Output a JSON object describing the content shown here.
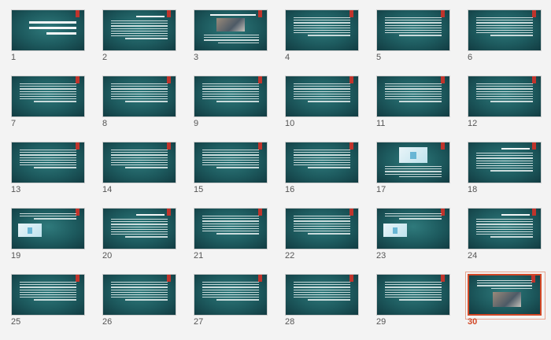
{
  "window": {
    "title": ""
  },
  "slides": [
    {
      "number": "1",
      "layout": "title",
      "title_text": "پاورپوینت مدیریت داده چه چیزی است و چه اهمیتی در کسب و کار ها دارد؟"
    },
    {
      "number": "2",
      "layout": "text-title"
    },
    {
      "number": "3",
      "layout": "photo-top"
    },
    {
      "number": "4",
      "layout": "text"
    },
    {
      "number": "5",
      "layout": "text"
    },
    {
      "number": "6",
      "layout": "text"
    },
    {
      "number": "7",
      "layout": "text"
    },
    {
      "number": "8",
      "layout": "text"
    },
    {
      "number": "9",
      "layout": "text"
    },
    {
      "number": "10",
      "layout": "text"
    },
    {
      "number": "11",
      "layout": "text"
    },
    {
      "number": "12",
      "layout": "text"
    },
    {
      "number": "13",
      "layout": "text"
    },
    {
      "number": "14",
      "layout": "text"
    },
    {
      "number": "15",
      "layout": "text"
    },
    {
      "number": "16",
      "layout": "text"
    },
    {
      "number": "17",
      "layout": "illus-top"
    },
    {
      "number": "18",
      "layout": "text-title"
    },
    {
      "number": "19",
      "layout": "illus-left"
    },
    {
      "number": "20",
      "layout": "text-title"
    },
    {
      "number": "21",
      "layout": "text"
    },
    {
      "number": "22",
      "layout": "text"
    },
    {
      "number": "23",
      "layout": "illus-left"
    },
    {
      "number": "24",
      "layout": "text-title"
    },
    {
      "number": "25",
      "layout": "text"
    },
    {
      "number": "26",
      "layout": "text"
    },
    {
      "number": "27",
      "layout": "text"
    },
    {
      "number": "28",
      "layout": "text"
    },
    {
      "number": "29",
      "layout": "text"
    },
    {
      "number": "30",
      "layout": "photo-bottom",
      "selected": true
    }
  ],
  "colors": {
    "slide_bg": "#1d5a5e",
    "accent_flag": "#c0342c",
    "selection": "#d24726"
  }
}
